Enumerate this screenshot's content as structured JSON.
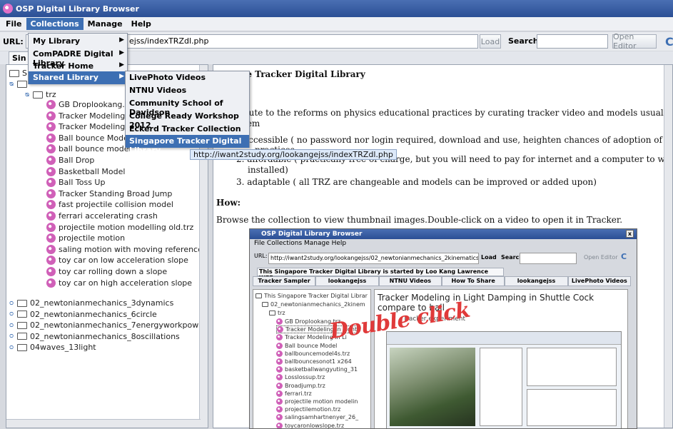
{
  "window": {
    "title": "OSP Digital Library Browser"
  },
  "menubar": {
    "items": [
      "File",
      "Collections",
      "Manage",
      "Help"
    ]
  },
  "toolbar": {
    "url_label": "URL:",
    "url_value": "ejss/indexTRZdl.php",
    "load_label": "Load",
    "search_label": "Search",
    "search_value": "",
    "open_editor_label": "Open Editor"
  },
  "tab": {
    "label": "Sin"
  },
  "collections_menu": {
    "items": [
      {
        "label": "My Library"
      },
      {
        "label": "ComPADRE Digital Library"
      },
      {
        "label": "Tracker Home Library"
      },
      {
        "label": "Shared Library"
      }
    ]
  },
  "shared_submenu": {
    "items": [
      {
        "label": "LivePhoto Videos"
      },
      {
        "label": "NTNU Videos"
      },
      {
        "label": "Community School of Davidson"
      },
      {
        "label": "College Ready Workshop 2012"
      },
      {
        "label": "Eckerd Tracker Collection"
      },
      {
        "label": "Singapore Tracker Digital Library"
      }
    ]
  },
  "tooltip": "http://iwant2study.org/lookangejss/indexTRZdl.php",
  "tree": {
    "root_label": "S",
    "sub_folder": "trz",
    "files": [
      "GB Droplookang.trz",
      "Tracker Modeling in",
      "Tracker Modeling in",
      "Ball bounce Model",
      "ball bounce model",
      "Ball Drop",
      "Basketball Model",
      "Ball Toss Up",
      "Tracker Standing Broad Jump",
      "fast projectile collision model",
      "ferrari accelerating crash",
      "projectile motion modelling old.trz",
      "projectile motion",
      "saling motion with moving reference frame",
      "toy car on low acceleration slope",
      "toy car rolling down a slope",
      "toy car on high acceleration slope"
    ],
    "folders": [
      "02_newtonianmechanics_3dynamics",
      "02_newtonianmechanics_6circle",
      "02_newtonianmechanics_7energyworkpower",
      "02_newtonianmechanics_8oscillations",
      "04waves_13light"
    ]
  },
  "content": {
    "heading": "re Tracker Digital Library",
    "line1": "bute to the reforms on physics educational practices by curating tracker video and models usually made by lookang,",
    "line2": "tem",
    "line3": "accessible ( no password nor login required, download and use, heighten chances of adoption of educational resources and",
    "line3b": "practices",
    "line4": "2.  affordable ( practically free of charge, but you will need to pay for internet and a computer to with tracker software",
    "line4b": "installed)",
    "line5": "3.  adaptable ( all TRZ are changeable and models can be improved or added upon)",
    "how_heading": "How:",
    "how_text": "Browse the collection to view thumbnail images.Double-click on a video to open it in Tracker."
  },
  "inner_window": {
    "title": "OSP Digital Library Browser",
    "menu": "File   Collections   Manage   Help",
    "url_label": "URL:",
    "url_value": "http://iwant2study.org/lookangejss/02_newtonianmechanics_2kinematics/trz/",
    "load_label": "Load",
    "search_label": "Search",
    "open_editor_label": "Open Editor",
    "banner": "This Singapore Tracker Digital Library is started by Loo Kang   Lawrence WEE.",
    "tabs": [
      "Tracker Sampler",
      "lookangejss",
      "NTNU Videos",
      "How To Share",
      "lookangejss",
      "LivePhoto Videos"
    ],
    "tree_root": "This Singapore Tracker Digital Librar",
    "tree_folder": "02_newtonianmechanics_2kinem",
    "tree_sub": "trz",
    "tree_files": [
      "GB Droplookang.trz",
      "Tracker Modeling in Light",
      "Tracker Modeling in Li",
      "Ball bounce Model",
      "ballbouncemodel4s.trz",
      "ballbouncesonot1 x264",
      "basketballwangyuting_31",
      "Losslossup.trz",
      "Broadjump.trz",
      "ferrari.trz",
      "projectile motion modelin",
      "projectilemotion.trz",
      "salingsamhartnenyer_26_",
      "toycaronlowslope.trz"
    ],
    "content_title": "Tracker Modeling in Light Damping in Shuttle Cock compare to ball",
    "content_sub": "Tracker experiment"
  },
  "annotation": "Double click"
}
